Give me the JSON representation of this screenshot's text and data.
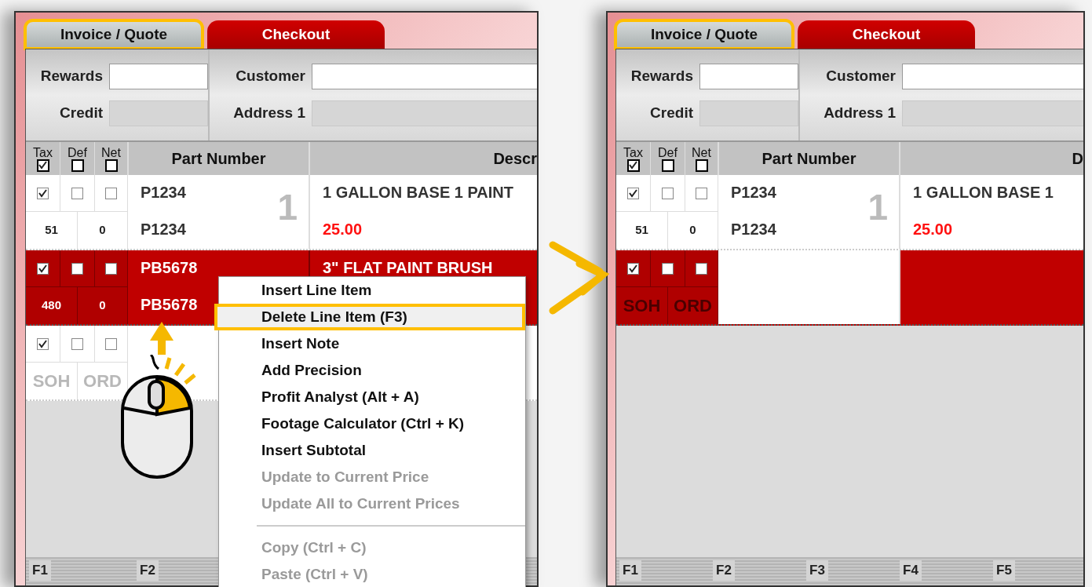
{
  "panels": [
    {
      "tabs": [
        {
          "label": "Invoice / Quote",
          "selected": true,
          "annotated": true
        },
        {
          "label": "Checkout",
          "selected": false,
          "annotated": false
        }
      ],
      "left_fields": [
        {
          "label": "Rewards",
          "disabled": false
        },
        {
          "label": "Credit",
          "disabled": true
        }
      ],
      "right_fields": [
        {
          "label": "Customer",
          "disabled": false
        },
        {
          "label": "Address 1",
          "disabled": true
        }
      ],
      "columns": {
        "checks": [
          {
            "label": "Tax",
            "checked": true
          },
          {
            "label": "Def",
            "checked": false
          },
          {
            "label": "Net",
            "checked": false
          }
        ],
        "part_number": "Part Number",
        "description": "Descr"
      },
      "rows": [
        {
          "selected": false,
          "checks": [
            {
              "checked": true
            },
            {
              "checked": false
            },
            {
              "checked": false
            }
          ],
          "soh": "51",
          "ord": "0",
          "part_number": "P1234",
          "part_number_2": "P1234",
          "line_no": "1",
          "description": "1 GALLON BASE 1 PAINT",
          "price": "25.00"
        },
        {
          "selected": true,
          "checks": [
            {
              "checked": true
            },
            {
              "checked": false
            },
            {
              "checked": false
            }
          ],
          "soh": "480",
          "ord": "0",
          "part_number": "PB5678",
          "part_number_2": "PB5678",
          "description": "3\" FLAT PAINT BRUSH"
        },
        {
          "selected": false,
          "checks": [
            {
              "checked": true
            },
            {
              "checked": false
            },
            {
              "checked": false
            }
          ],
          "soh_placeholder": "SOH",
          "ord_placeholder": "ORD"
        }
      ],
      "function_keys": [
        "F1",
        "F2"
      ]
    },
    {
      "tabs": [
        {
          "label": "Invoice / Quote",
          "selected": true,
          "annotated": true
        },
        {
          "label": "Checkout",
          "selected": false,
          "annotated": false
        }
      ],
      "left_fields": [
        {
          "label": "Rewards",
          "disabled": false
        },
        {
          "label": "Credit",
          "disabled": true
        }
      ],
      "right_fields": [
        {
          "label": "Customer",
          "disabled": false
        },
        {
          "label": "Address 1",
          "disabled": true
        }
      ],
      "columns": {
        "checks": [
          {
            "label": "Tax",
            "checked": true
          },
          {
            "label": "Def",
            "checked": false
          },
          {
            "label": "Net",
            "checked": false
          }
        ],
        "part_number": "Part Number",
        "description": "D"
      },
      "rows": [
        {
          "selected": false,
          "checks": [
            {
              "checked": true
            },
            {
              "checked": false
            },
            {
              "checked": false
            }
          ],
          "soh": "51",
          "ord": "0",
          "part_number": "P1234",
          "part_number_2": "P1234",
          "line_no": "1",
          "description": "1 GALLON BASE 1",
          "price": "25.00"
        },
        {
          "selected": true,
          "checks": [
            {
              "checked": true
            },
            {
              "checked": false
            },
            {
              "checked": false
            }
          ],
          "soh_placeholder": "SOH",
          "ord_placeholder": "ORD"
        }
      ],
      "function_keys": [
        "F1",
        "F2",
        "F3",
        "F4",
        "F5"
      ]
    }
  ],
  "context_menu": {
    "items": [
      {
        "kind": "item",
        "label": "Insert Line Item",
        "disabled": false,
        "selected": false,
        "annotated": false
      },
      {
        "kind": "item",
        "label": "Delete Line Item (F3)",
        "disabled": false,
        "selected": true,
        "annotated": true
      },
      {
        "kind": "item",
        "label": "Insert Note",
        "disabled": false,
        "selected": false,
        "annotated": false
      },
      {
        "kind": "item",
        "label": "Add Precision",
        "disabled": false,
        "selected": false,
        "annotated": false
      },
      {
        "kind": "item",
        "label": "Profit Analyst (Alt + A)",
        "disabled": false,
        "selected": false,
        "annotated": false
      },
      {
        "kind": "item",
        "label": "Footage Calculator (Ctrl + K)",
        "disabled": false,
        "selected": false,
        "annotated": false
      },
      {
        "kind": "item",
        "label": "Insert Subtotal",
        "disabled": false,
        "selected": false,
        "annotated": false
      },
      {
        "kind": "item",
        "label": "Update to Current Price",
        "disabled": true,
        "selected": false,
        "annotated": false
      },
      {
        "kind": "item",
        "label": "Update All to Current Prices",
        "disabled": true,
        "selected": false,
        "annotated": false
      },
      {
        "kind": "separator"
      },
      {
        "kind": "item",
        "label": "Copy (Ctrl + C)",
        "disabled": true,
        "selected": false,
        "annotated": false
      },
      {
        "kind": "item",
        "label": "Paste (Ctrl + V)",
        "disabled": true,
        "selected": false,
        "annotated": false
      }
    ]
  }
}
